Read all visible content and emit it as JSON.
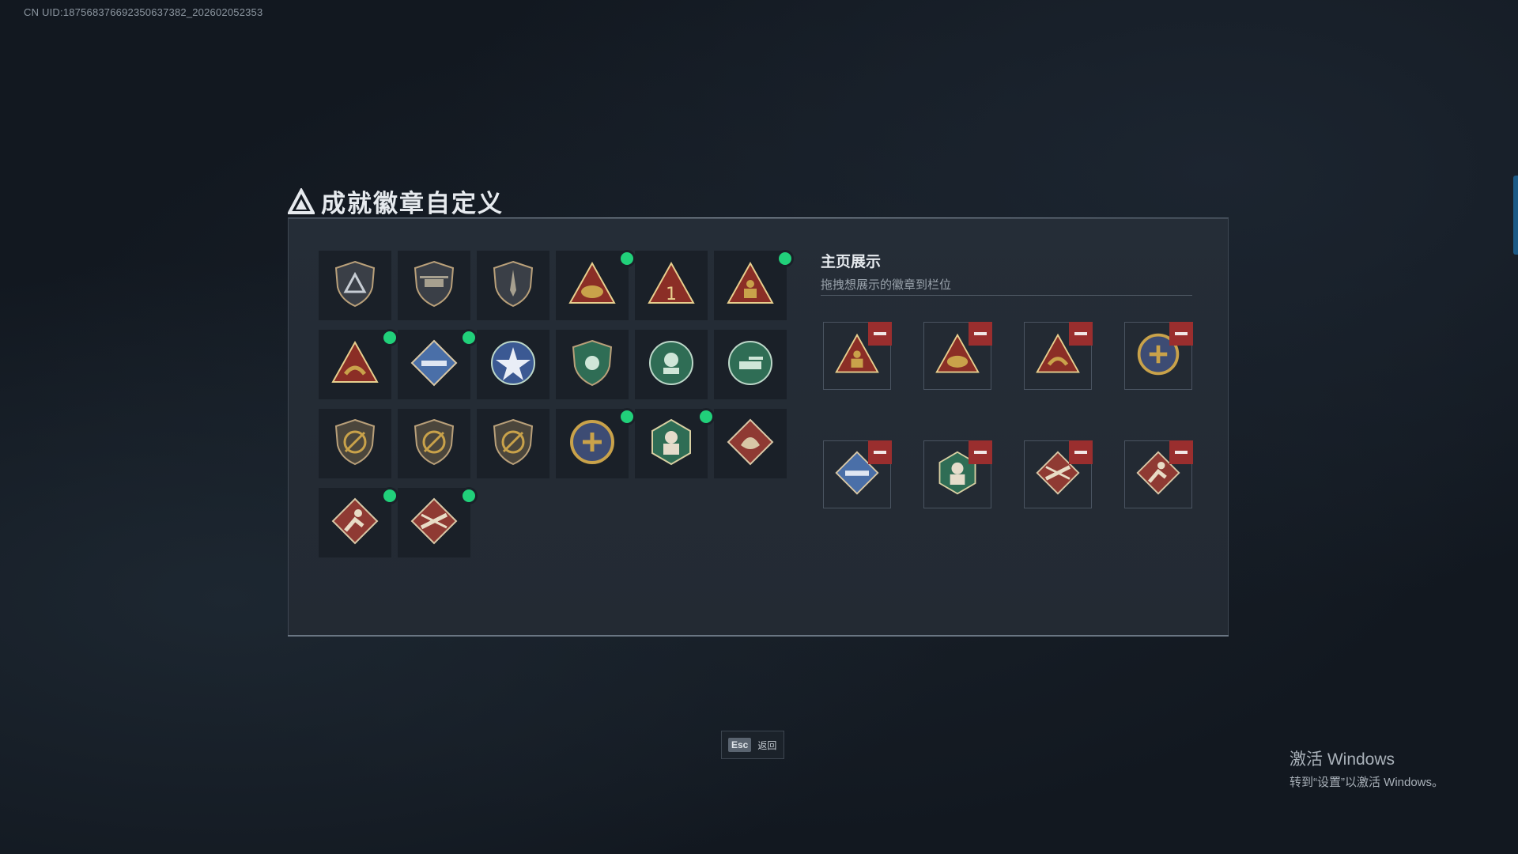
{
  "uid_label": "CN UID:18756837669235063​7382_202602052353",
  "title": "成就徽章自定义",
  "showcase": {
    "title": "主页展示",
    "subtitle": "拖拽想展示的徽章到栏位"
  },
  "badges": [
    {
      "icon": "shield-triangle-icon",
      "new": false
    },
    {
      "icon": "helicopter-shield-icon",
      "new": false
    },
    {
      "icon": "spear-shield-icon",
      "new": false
    },
    {
      "icon": "gold-triangle-helmet-icon",
      "new": true
    },
    {
      "icon": "red-triangle-number-one-icon",
      "new": false
    },
    {
      "icon": "gold-triangle-soldier-icon",
      "new": true
    },
    {
      "icon": "gold-triangle-hands-icon",
      "new": true
    },
    {
      "icon": "blue-diamond-launcher-icon",
      "new": true
    },
    {
      "icon": "blue-star-badge-icon",
      "new": false
    },
    {
      "icon": "green-shield-badge-icon",
      "new": false
    },
    {
      "icon": "green-soldier-wreath-icon",
      "new": false
    },
    {
      "icon": "green-tank-wreath-icon",
      "new": false
    },
    {
      "icon": "gold-shield-rifle-icon",
      "new": false
    },
    {
      "icon": "gold-shield-rifle-icon",
      "new": false
    },
    {
      "icon": "gold-shield-rifle-icon",
      "new": false
    },
    {
      "icon": "gold-winged-emblem-icon",
      "new": true
    },
    {
      "icon": "green-hexagon-soldier-icon",
      "new": true
    },
    {
      "icon": "red-diamond-dragon-icon",
      "new": false
    },
    {
      "icon": "red-diamond-runner-icon",
      "new": true
    },
    {
      "icon": "red-diamond-crossed-rifles-icon",
      "new": true
    }
  ],
  "slots": [
    {
      "icon": "gold-triangle-soldier-icon"
    },
    {
      "icon": "gold-triangle-helmet-icon"
    },
    {
      "icon": "gold-triangle-hands-icon"
    },
    {
      "icon": "gold-winged-emblem-icon"
    },
    {
      "icon": "blue-diamond-launcher-icon"
    },
    {
      "icon": "green-hexagon-soldier-icon"
    },
    {
      "icon": "red-diamond-crossed-rifles-icon"
    },
    {
      "icon": "red-diamond-runner-icon"
    }
  ],
  "esc": {
    "key": "Esc",
    "label": "返回"
  },
  "windows": {
    "title": "激活 Windows",
    "subtitle": "转到“设置”以激活 Windows。"
  },
  "colors": {
    "accent_green": "#21d07a",
    "remove_red": "#9a2e2e",
    "gold": "#c9a24a",
    "bronze": "#7d6a4e",
    "blue": "#4a6fa8",
    "green": "#2f6d55",
    "red": "#8f3a33"
  }
}
